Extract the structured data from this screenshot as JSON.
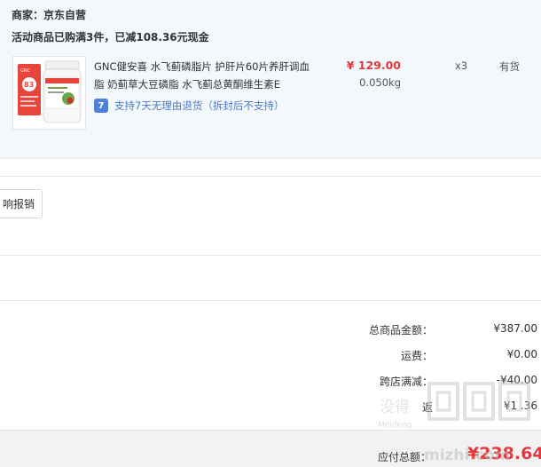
{
  "order": {
    "merchant": "商家：京东自营",
    "promo": "活动商品已购满3件，已减108.36元现金",
    "product": {
      "title": "GNC健安喜 水飞蓟磷脂片 护肝片60片养肝调血脂 奶蓟草大豆磷脂 水飞蓟总黄酮维生素E",
      "return_policy": "支持7天无理由退货（拆封后不支持）",
      "return_badge": "7",
      "price": "¥ 129.00",
      "weight": "0.050kg",
      "quantity": "x3",
      "stock": "有货",
      "image": {
        "brand": "GNC",
        "badge": "83"
      }
    }
  },
  "invoice": {
    "button_label": "响报销"
  },
  "summary": {
    "rows": [
      {
        "label": "总商品金额：",
        "value": "¥387.00"
      },
      {
        "label": "运费：",
        "value": "¥0.00"
      },
      {
        "label": "跨店满减：",
        "value": "-¥40.00"
      },
      {
        "label": "返",
        "value": "¥1 .36"
      }
    ],
    "total_label": "应付总额：",
    "total_value": "¥238.64"
  },
  "watermark": {
    "text_cn": "没得",
    "text_en": "Meideng",
    "text_url": "mizhi.com"
  },
  "colors": {
    "accent_red": "#e4393c",
    "link_blue": "#4a78c8",
    "panel_bg": "#f3f8fd"
  }
}
